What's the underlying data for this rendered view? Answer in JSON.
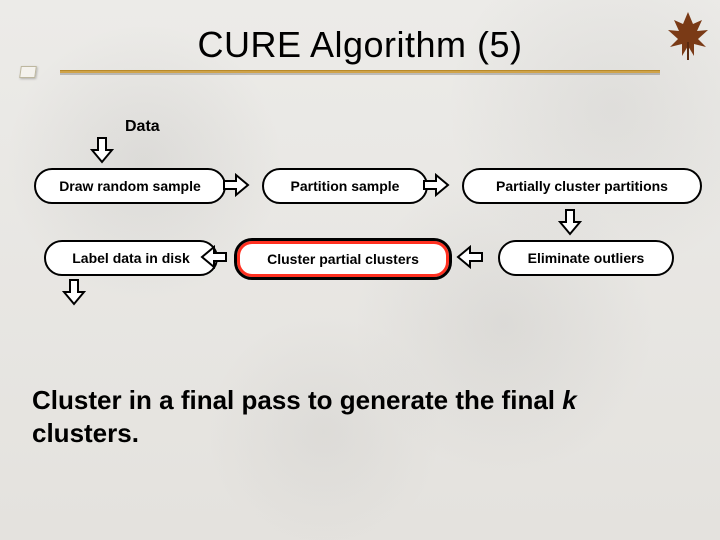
{
  "title": "CURE Algorithm (5)",
  "flow": {
    "data_label": "Data",
    "boxes": {
      "draw_random_sample": "Draw random sample",
      "partition_sample": "Partition sample",
      "partially_cluster_partitions": "Partially cluster partitions",
      "label_data_in_disk": "Label data in disk",
      "cluster_partial_clusters": "Cluster partial clusters",
      "eliminate_outliers": "Eliminate outliers"
    }
  },
  "final_line_prefix": "Cluster in a final pass to generate the final ",
  "final_k": "k",
  "final_line_suffix": " clusters."
}
